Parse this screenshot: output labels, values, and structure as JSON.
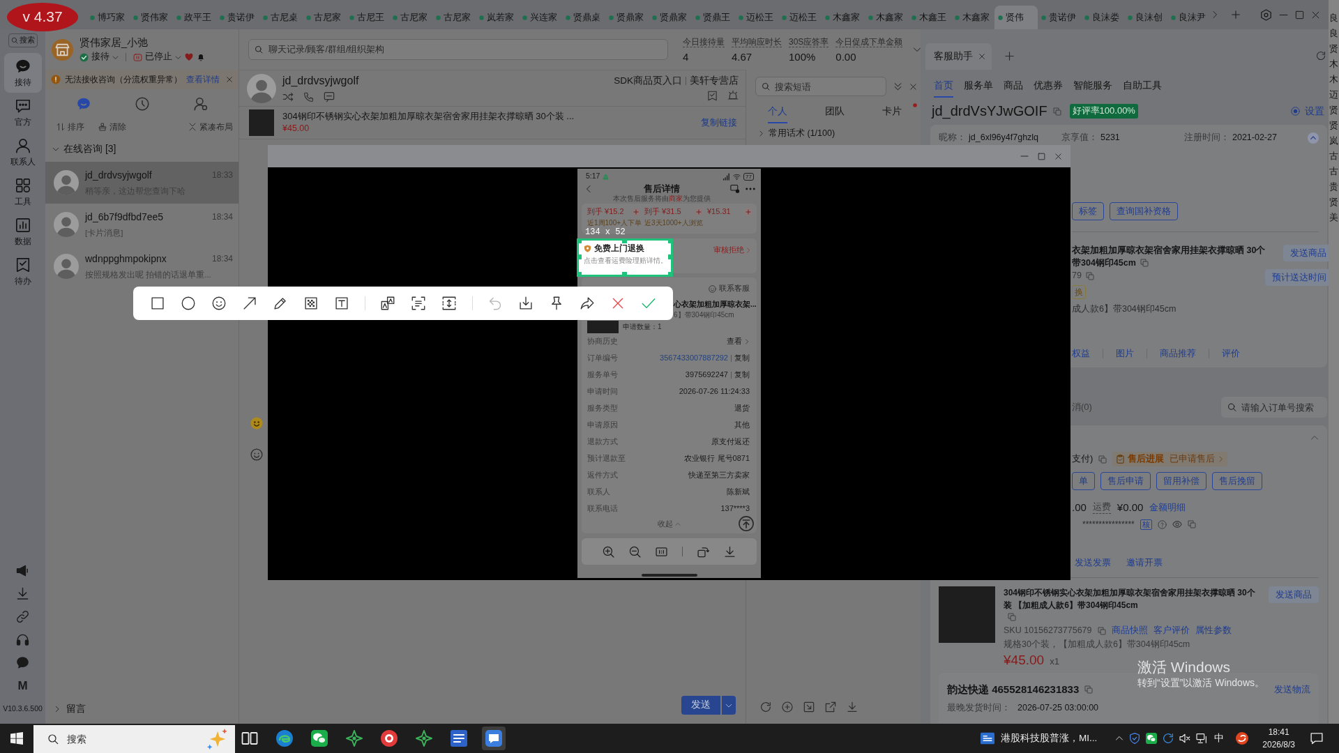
{
  "version_badge": {
    "text": "v 4.37"
  },
  "shop_tabs": [
    {
      "label": "博巧家",
      "selected": false
    },
    {
      "label": "贤伟家",
      "selected": false
    },
    {
      "label": "政平王",
      "selected": false
    },
    {
      "label": "贵诺伊",
      "selected": false
    },
    {
      "label": "古尼桌",
      "selected": false
    },
    {
      "label": "古尼家",
      "selected": false
    },
    {
      "label": "古尼王",
      "selected": false
    },
    {
      "label": "古尼家",
      "selected": false
    },
    {
      "label": "古尼家",
      "selected": false
    },
    {
      "label": "岚若家",
      "selected": false
    },
    {
      "label": "兴连家",
      "selected": false
    },
    {
      "label": "贤鼎桌",
      "selected": false
    },
    {
      "label": "贤鼎家",
      "selected": false
    },
    {
      "label": "贤鼎家",
      "selected": false
    },
    {
      "label": "贤鼎王",
      "selected": false
    },
    {
      "label": "迈松王",
      "selected": false
    },
    {
      "label": "迈松王",
      "selected": false
    },
    {
      "label": "木鑫家",
      "selected": false
    },
    {
      "label": "木鑫家",
      "selected": false
    },
    {
      "label": "木鑫王",
      "selected": false
    },
    {
      "label": "木鑫家",
      "selected": false
    },
    {
      "label": "贤伟",
      "selected": true
    },
    {
      "label": "贵诺伊",
      "selected": false
    },
    {
      "label": "良沫娄",
      "selected": false
    },
    {
      "label": "良沫创",
      "selected": false
    },
    {
      "label": "良沫尹",
      "selected": false
    }
  ],
  "nav_rail": {
    "search": "搜索",
    "items": [
      {
        "label": "接待",
        "selected": true
      },
      {
        "label": "官方",
        "selected": false
      },
      {
        "label": "联系人",
        "selected": false
      },
      {
        "label": "工具",
        "selected": false
      },
      {
        "label": "数据",
        "selected": false
      },
      {
        "label": "待办",
        "selected": false
      }
    ],
    "logo": "M",
    "version": "V10.3.6.500"
  },
  "chat_list": {
    "shop_name": "贤伟家居_小弛",
    "reception_status": "接待",
    "service_status": "已停止",
    "alert": {
      "text": "无法接收咨询（分流权重异常）",
      "link": "查看详情"
    },
    "view_tabs": [
      {
        "selected": true
      },
      {
        "selected": false
      },
      {
        "selected": false
      }
    ],
    "actions": [
      "排序",
      "清除",
      "紧凑布局"
    ],
    "group": {
      "label": "在线咨询 [3]",
      "expanded": true
    },
    "conversations": [
      {
        "name": "jd_drdvsyjwgolf",
        "time": "18:33",
        "preview": "稍等亲，这边帮您查询下哈",
        "selected": true
      },
      {
        "name": "jd_6b7f9dfbd7ee5",
        "time": "18:34",
        "preview": "[卡片消息]",
        "selected": false
      },
      {
        "name": "wdnppghmpokipnx",
        "time": "18:34",
        "preview": "按照规格发出呢 拍错的话退单重...",
        "selected": false
      }
    ],
    "footer": {
      "label": "留言",
      "expanded": false
    }
  },
  "top_search": {
    "placeholder": "聊天记录/顾客/群组/组织架构"
  },
  "stats": [
    {
      "label": "今日接待量",
      "value": "4"
    },
    {
      "label": "平均响应时长",
      "value": "4.67"
    },
    {
      "label": "30S应答率",
      "value": "100%"
    },
    {
      "label": "今日促成下单金额",
      "value": "0.00"
    }
  ],
  "chat": {
    "customer": "jd_drdvsyjwgolf",
    "source": "SDK商品页入口",
    "store": "美轩专营店",
    "product": {
      "title": "304钢印不锈钢实心衣架加粗加厚晾衣架宿舍家用挂架衣撑晾晒 30个装 ...",
      "price": "¥45.00",
      "link": "复制链接"
    },
    "send": "发送"
  },
  "phrases": {
    "search": {
      "placeholder": "搜索短语"
    },
    "tabs": [
      {
        "label": "个人",
        "selected": true,
        "notify": false
      },
      {
        "label": "团队",
        "selected": false,
        "notify": false
      },
      {
        "label": "卡片",
        "selected": false,
        "notify": true
      }
    ],
    "category": {
      "label": "常用话术 (1/100)",
      "expanded": false
    }
  },
  "assistant": {
    "tab": "客服助手",
    "nav": [
      {
        "label": "首页",
        "selected": true
      },
      {
        "label": "服务单",
        "selected": false
      },
      {
        "label": "商品",
        "selected": false
      },
      {
        "label": "优惠券",
        "selected": false
      },
      {
        "label": "智能服务",
        "selected": false
      },
      {
        "label": "自助工具",
        "selected": false
      }
    ],
    "customer_id": "jd_drdVsYJwGOIF",
    "rating": "好评率100.00%",
    "setting": {
      "label": "设置",
      "checked": true
    },
    "profile": [
      {
        "label": "昵称：",
        "value": "jd_6xl96y4f7ghzlq"
      },
      {
        "label": "京享值：",
        "value": "5231"
      },
      {
        "label": "注册时间：",
        "value": "2021-02-27"
      }
    ],
    "profile_expanded": true,
    "profile_buttons": [
      "标签",
      "查询国补资格"
    ],
    "recent_product": {
      "title": "衣架加粗加厚晾衣架宿舍家用挂架衣撑晾晒 30个",
      "title_end": "带304钢印45cm",
      "sku_end": "79",
      "tag": "换",
      "spec": "成人款6】带304钢印45cm",
      "buttons": [
        "发送商品",
        "预计送达时间"
      ]
    },
    "links": [
      "权益",
      "图片",
      "商品推荐",
      "评价"
    ],
    "orders": {
      "filter": "消(0)",
      "search": {
        "placeholder": "请输入订单号搜索"
      },
      "expanded": true,
      "payment": "支付)",
      "progress": {
        "label": "售后进展",
        "value": "已申请售后"
      },
      "buttons": [
        "单",
        "售后申请",
        "留用补偿",
        "售后挽留"
      ],
      "amount": ".00",
      "freight_label": "运费",
      "freight": "¥0.00",
      "details_link": "金额明细",
      "masked": "****************",
      "verify": "核",
      "invoice_links": [
        "发送发票",
        "邀请开票"
      ],
      "item": {
        "title": "304钢印不锈钢实心衣架加粗加厚晾衣架宿舍家用挂架衣撑晾晒 30个装 【加粗成人款6】带304钢印45cm",
        "sku": "SKU 10156273775679",
        "links": [
          "商品快照",
          "客户评价",
          "属性参数"
        ],
        "spec": "规格30个装，【加粗成人款6】带304钢印45cm",
        "price": "¥45.00",
        "quantity": "x1",
        "button": "发送商品"
      },
      "shipment": {
        "tracking": "韵达快递 465528146231833",
        "link": "发送物流",
        "deadline_label": "最晚发货时间：",
        "deadline": "2026-07-25 03:00:00"
      }
    }
  },
  "viewer": {
    "phone": {
      "time": "5:17",
      "battery": "77",
      "title": "售后详情",
      "subtitle": {
        "before": "本次售后服务将由",
        "highlight": "商家",
        "after": "为您提供"
      },
      "offers": [
        {
          "price": "到手 ¥15.2",
          "note": "近1周100+人下单"
        },
        {
          "price": "到手 ¥31.5",
          "note": "近3天1000+人浏览"
        },
        {
          "price": "¥15.31"
        }
      ],
      "service_status": "审核拒绝",
      "contact": "联系客服",
      "item_title": "心衣架加粗加厚晾衣架...",
      "item_spec": "6】带304钢印45cm",
      "quantity": "申请数量：1",
      "rows": [
        {
          "label": "协商历史",
          "value": "查看",
          "kind": "more"
        },
        {
          "label": "订单编号",
          "value": "3567433007887292",
          "action": "复制",
          "kind": "order"
        },
        {
          "label": "服务单号",
          "value": "3975692247",
          "action": "复制",
          "kind": "copy"
        },
        {
          "label": "申请时间",
          "value": "2026-07-26 11:24:33",
          "kind": "plain"
        },
        {
          "label": "服务类型",
          "value": "退货",
          "kind": "plain"
        },
        {
          "label": "申请原因",
          "value": "其他",
          "kind": "plain"
        },
        {
          "label": "退款方式",
          "value": "原支付返还",
          "kind": "plain"
        },
        {
          "label": "预计退款至",
          "value": "农业银行 尾号0871",
          "kind": "plain"
        },
        {
          "label": "返件方式",
          "value": "快递至第三方卖家",
          "kind": "plain"
        },
        {
          "label": "联系人",
          "value": "陈新斌",
          "kind": "plain"
        },
        {
          "label": "联系电话",
          "value": "137****3",
          "kind": "plain"
        }
      ],
      "collapse": "收起"
    }
  },
  "capture": {
    "size": "134 x 52",
    "service": {
      "title": "免费上门退换",
      "description": "点击查看运费险理赔详情。"
    },
    "tools": [
      {
        "disabled": false
      },
      {
        "disabled": false
      },
      {
        "disabled": false
      },
      {
        "disabled": false
      },
      {
        "disabled": false
      },
      {
        "disabled": false
      },
      {
        "disabled": false
      },
      {
        "disabled": false
      },
      {
        "disabled": false
      },
      {
        "disabled": false
      },
      {
        "disabled": true
      },
      {
        "disabled": false
      },
      {
        "disabled": false
      },
      {
        "disabled": false
      },
      {
        "disabled": false
      },
      {
        "disabled": false
      }
    ]
  },
  "activation": {
    "title": "激活 Windows",
    "hint": "转到“设置”以激活 Windows。"
  },
  "edge_labels": [
    "良",
    "良",
    "贤",
    "木",
    "木",
    "迈",
    "贤",
    "贤",
    "岚",
    "古",
    "古",
    "贵",
    "贤",
    "美"
  ],
  "taskbar": {
    "search": {
      "placeholder": "搜索"
    },
    "apps": [
      {
        "selected": false
      },
      {
        "selected": false
      },
      {
        "selected": false
      },
      {
        "selected": false
      },
      {
        "selected": false
      },
      {
        "selected": false
      },
      {
        "selected": false
      },
      {
        "selected": true
      }
    ],
    "news": "港股科技股普涨，MI...",
    "ime": "中",
    "time": "18:41",
    "date": "2026/8/3"
  }
}
